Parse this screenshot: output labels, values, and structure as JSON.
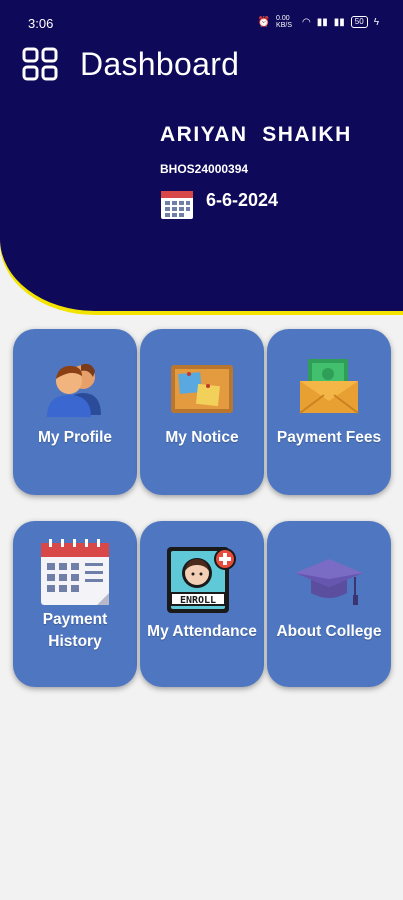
{
  "status": {
    "time": "3:06",
    "speed": "0.00 KB/S",
    "battery": "50"
  },
  "header": {
    "title": "Dashboard",
    "student_name": "ARIYAN  SHAIKH",
    "student_id": "BHOS24000394",
    "date": "6-6-2024"
  },
  "tiles": [
    {
      "label": "My Profile",
      "icon": "users-icon"
    },
    {
      "label": "My Notice",
      "icon": "notice-board-icon"
    },
    {
      "label": "Payment Fees",
      "icon": "money-envelope-icon"
    },
    {
      "label": "Payment\nHistory",
      "icon": "calendar-icon"
    },
    {
      "label": "My Attendance",
      "icon": "enroll-badge-icon"
    },
    {
      "label": "About College",
      "icon": "graduation-cap-icon"
    }
  ],
  "colors": {
    "header": "#0e0958",
    "accent": "#f2e400",
    "tile": "#4f77c1",
    "background": "#f2f2f2"
  }
}
